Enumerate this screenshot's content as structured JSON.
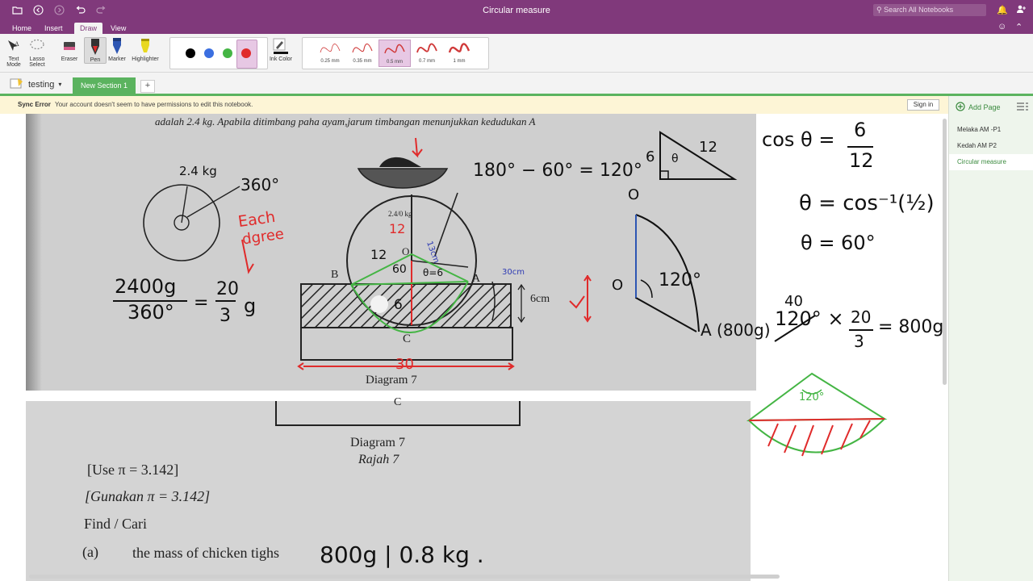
{
  "window": {
    "title": "Circular measure"
  },
  "titlebar": {
    "search_placeholder": "Search All Notebooks"
  },
  "ribbon_tabs": [
    "Home",
    "Insert",
    "Draw",
    "View"
  ],
  "ribbon": {
    "tools": [
      {
        "label": "Text Mode"
      },
      {
        "label": "Lasso Select"
      },
      {
        "label": "Eraser"
      },
      {
        "label": "Pen"
      },
      {
        "label": "Marker"
      },
      {
        "label": "Highlighter"
      }
    ],
    "colors": [
      "#000000",
      "#3b6fe0",
      "#44b544",
      "#e02b2b"
    ],
    "ink_color_label": "Ink Color",
    "thicknesses": [
      "0.25 mm",
      "0.35 mm",
      "0.5 mm",
      "0.7 mm",
      "1 mm"
    ]
  },
  "notebook": {
    "name": "testing"
  },
  "section": {
    "name": "New Section 1",
    "add_label": "+"
  },
  "sync": {
    "label": "Sync Error",
    "message": "Your account doesn't seem to have permissions to edit this notebook.",
    "signin": "Sign in"
  },
  "pages_panel": {
    "add_label": "Add Page",
    "pages": [
      "Melaka AM -P1",
      "Kedah AM P2",
      "Circular measure"
    ]
  },
  "scan": {
    "top_line": "adalah 2.4 kg. Apabila ditimbang paha ayam,jarum timbangan menunjukkan kedudukan A",
    "labels": {
      "b": "B",
      "a": "A",
      "c": "C",
      "o": "O",
      "dim_6cm": "6cm",
      "scale_text": "2.4/0 kg",
      "diagram": "Diagram 7"
    },
    "lower": {
      "c": "C",
      "diagram": "Diagram 7",
      "rajah": "Rajah 7",
      "use_pi": "[Use π = 3.142]",
      "gunakan_pi": "[Gunakan π = 3.142]",
      "find": "Find / Cari",
      "part_a_num": "(a)",
      "part_a_text": "the mass of chicken tighs"
    }
  },
  "annotations": {
    "mass_label": "2.4 kg",
    "deg360": "360°",
    "each_degree": [
      "Each",
      "dgree"
    ],
    "frac_num": "2400g",
    "frac_den": "360°",
    "eq_20": "20",
    "eq_3": "3",
    "eq_g": "g",
    "twelve_a": "12",
    "twelve_b": "12",
    "six_a": "60",
    "theta6": "θ=6",
    "cm13": "13cm",
    "six_b": "6",
    "thirty": "30",
    "cm30": "30cm",
    "angle_calc": "180° − 60° = 120°",
    "tri_6": "6",
    "tri_12": "12",
    "tri_theta": "θ",
    "cos_lhs": "cos θ =",
    "cos_num": "6",
    "cos_den": "12",
    "theta_inv": "θ = cos⁻¹(½)",
    "theta_60": "θ = 60°",
    "sector_o1": "O",
    "sector_o2": "O",
    "sector_angle": "120°",
    "sector_a": "A (800g)",
    "forty": "40",
    "mult_expr": "120° ×",
    "mult_20": "20",
    "mult_3": "3",
    "mult_result": "= 800g",
    "seg_angle": "120°",
    "answer": "800g | 0.8 kg ."
  }
}
